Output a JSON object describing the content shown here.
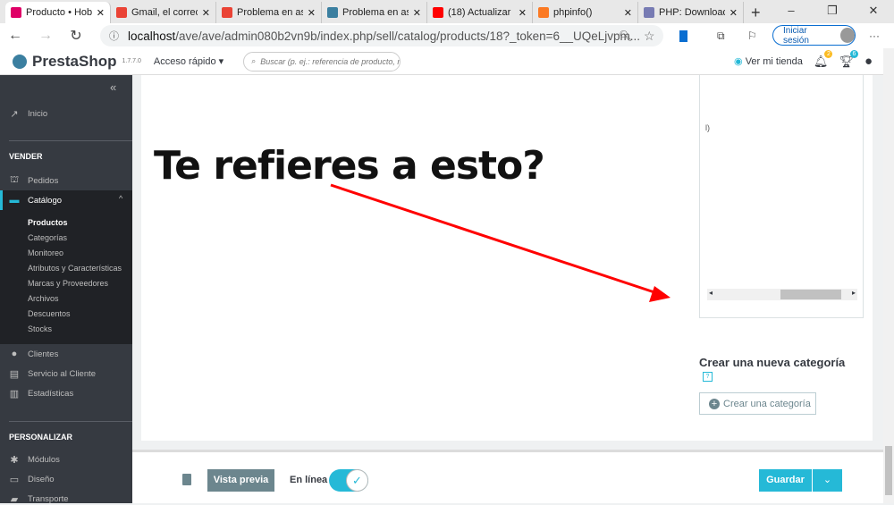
{
  "browser": {
    "tabs": [
      {
        "label": "Producto • Hob",
        "icon": "prestashop",
        "color": "#df0067"
      },
      {
        "label": "Gmail, el correo",
        "icon": "gmail",
        "color": "#ea4335"
      },
      {
        "label": "Problema en as",
        "icon": "gmail",
        "color": "#ea4335"
      },
      {
        "label": "Problema en as",
        "icon": "prestashop",
        "color": "#3b7fa0"
      },
      {
        "label": "(18) Actualizar",
        "icon": "youtube",
        "color": "#ff0000"
      },
      {
        "label": "phpinfo()",
        "icon": "xampp",
        "color": "#fb7a24"
      },
      {
        "label": "PHP: Download",
        "icon": "php",
        "color": "#777bb3"
      }
    ],
    "url_host": "localhost",
    "url_path": "/ave/ave/admin080b2vn9b/index.php/sell/catalog/products/18?_token=6__UQeLjvpm...",
    "signin": "Iniciar sesión"
  },
  "header": {
    "brand": "PrestaShop",
    "version": "1.7.7.0",
    "quick_access": "Acceso rápido",
    "search_placeholder": "Buscar (p. ej.: referencia de producto, nombre",
    "view_store": "Ver mi tienda",
    "notif_count": "2",
    "trophy_count": "6"
  },
  "sidebar": {
    "home": "Inicio",
    "section_sell": "VENDER",
    "orders": "Pedidos",
    "catalog": "Catálogo",
    "catalog_sub": [
      "Productos",
      "Categorías",
      "Monitoreo",
      "Atributos y Características",
      "Marcas y Proveedores",
      "Archivos",
      "Descuentos",
      "Stocks"
    ],
    "customers": "Clientes",
    "service": "Servicio al Cliente",
    "stats": "Estadísticas",
    "section_custom": "PERSONALIZAR",
    "modules": "Módulos",
    "design": "Diseño",
    "shipping": "Transporte"
  },
  "main": {
    "annotation": "Te refieres a esto?",
    "tree_fragment": "l)",
    "new_category_title": "Crear una nueva categoría",
    "help": "?",
    "create_category": "Crear una categoría"
  },
  "footer": {
    "preview": "Vista previa",
    "online": "En línea",
    "save": "Guardar"
  }
}
